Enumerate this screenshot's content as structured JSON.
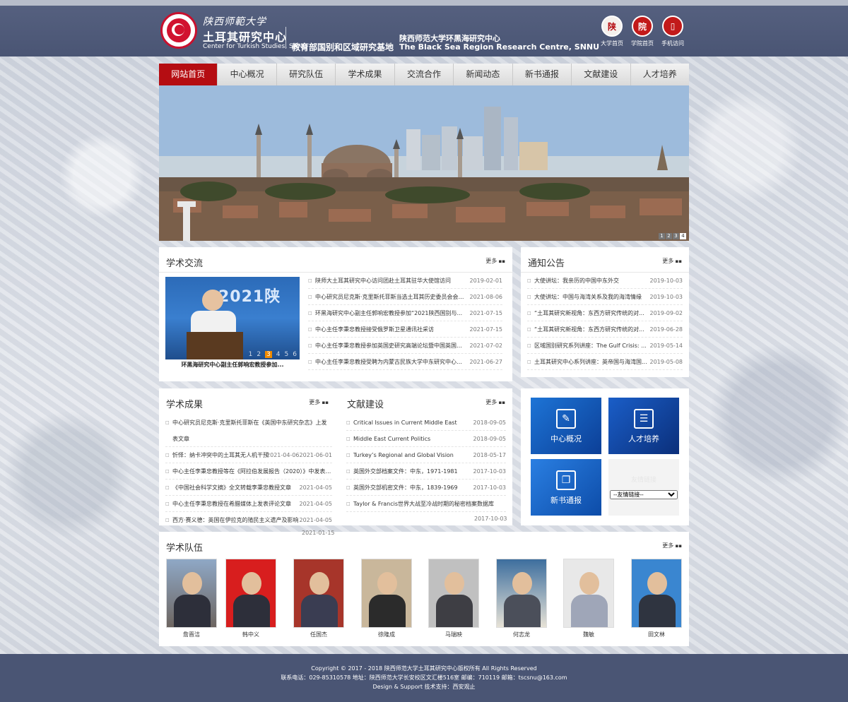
{
  "header": {
    "logo_cn_small": "陕西师範大学",
    "logo_cn_big": "土耳其研究中心",
    "logo_en": "Center for Turkish Studies, SNNU",
    "base_title": "教育部国别和区域研究基地",
    "bsrc_cn": "陕西师范大学环黑海研究中心",
    "bsrc_en": "The Black Sea Region Research Centre, SNNU",
    "quick_links": [
      {
        "label": "大学首页",
        "glyph": "陕"
      },
      {
        "label": "学院首页",
        "glyph": "院"
      },
      {
        "label": "手机访问",
        "glyph": "▯"
      }
    ]
  },
  "nav": [
    "网站首页",
    "中心概况",
    "研究队伍",
    "学术成果",
    "交流合作",
    "新闻动态",
    "新书通报",
    "文献建设",
    "人才培养"
  ],
  "banner": {
    "dots": [
      "1",
      "2",
      "3",
      "4"
    ],
    "active": "4"
  },
  "more_label": "更多",
  "academic_exchange": {
    "title": "学术交流",
    "feature_text": "2021陕",
    "feature_nums": [
      "1",
      "2",
      "3",
      "4",
      "5",
      "6"
    ],
    "feature_active": "3",
    "feature_caption": "环黑海研究中心副主任郭响宏教授参加...",
    "items": [
      {
        "t": "陕师大土耳其研究中心访问团赴土耳其驻华大使馆访问",
        "d": "2019-02-01"
      },
      {
        "t": "中心研究员尼克斯·克里斯托菲斯当选土耳其历史委员会会理事...",
        "d": "2021-08-06"
      },
      {
        "t": "环黑海研究中心副主任郭响宏教授参加“2021陕西国别与...",
        "d": "2021-07-15"
      },
      {
        "t": "中心主任李秉忠教授接受俄罗斯卫星通讯社采访",
        "d": "2021-07-15"
      },
      {
        "t": "中心主任李秉忠教授参加英国史研究高端论坛暨中国英国史...",
        "d": "2021-07-02"
      },
      {
        "t": "中心主任李秉忠教授受聘为内蒙古民族大学中东研究中心学...",
        "d": "2021-06-27"
      }
    ]
  },
  "notice": {
    "title": "通知公告",
    "items": [
      {
        "t": "大使讲坛：我亲历的中国中东外交",
        "d": "2019-10-03"
      },
      {
        "t": "大使讲坛：中国与海湾关系及我的海湾情缘",
        "d": "2019-10-03"
      },
      {
        "t": "“土耳其研究新视角：东西方研究传统的对...",
        "d": "2019-09-02"
      },
      {
        "t": "“土耳其研究新视角：东西方研究传统的对...",
        "d": "2019-06-28"
      },
      {
        "t": "区域国别研究系列讲座：The Gulf Crisis: ...",
        "d": "2019-05-14"
      },
      {
        "t": "土耳其研究中心系列讲座：英帝国与海湾国...",
        "d": "2019-05-08"
      }
    ]
  },
  "achievements": {
    "title": "学术成果",
    "items": [
      {
        "t": "中心研究员尼克斯·克里斯托菲斯在《英国中东研究杂志》上发表文章",
        "d": "",
        "wrap": true
      },
      {
        "t": "忻怿：纳卡冲突中的土耳其无人机干预",
        "d": "2021-04-062021-06-01"
      },
      {
        "t": "中心主任李秉忠教授等在《阿拉伯发展报告（2020）》中发表文章",
        "d": ""
      },
      {
        "t": "《中国社会科学文摘》全文转载李秉忠教授文章",
        "d": "2021-04-05"
      },
      {
        "t": "中心主任李秉忠教授在希腊媒体上发表评论文章",
        "d": "2021-04-05"
      },
      {
        "t": "西方·赛义德：英国在伊拉克的殖民主义遗产及影响",
        "d": "2021-04-05"
      }
    ],
    "last_date": "2021-01-15"
  },
  "literature": {
    "title": "文献建设",
    "items": [
      {
        "t": "Critical Issues in Current Middle East",
        "d": "2018-09-05"
      },
      {
        "t": "Middle East Current Politics",
        "d": "2018-09-05"
      },
      {
        "t": "Turkey’s Regional and Global Vision",
        "d": "2018-05-17"
      },
      {
        "t": "英国外交部档案文件：中东，1971-1981",
        "d": "2017-10-03"
      },
      {
        "t": "英国外交部机密文件：中东，1839-1969",
        "d": "2017-10-03"
      },
      {
        "t": "Taylor & Francis世界大战至冷战时期的秘密档案数据库",
        "d": ""
      }
    ],
    "last_date": "2017-10-03"
  },
  "tiles": [
    {
      "label": "中心概况",
      "icon": "edit-icon",
      "glyph": "✎"
    },
    {
      "label": "人才培养",
      "icon": "person-icon",
      "glyph": "☰"
    },
    {
      "label": "新书通报",
      "icon": "book-icon",
      "glyph": "❐"
    }
  ],
  "friend_links": {
    "heading": "友情链接",
    "selected": "--友情链接--"
  },
  "team": {
    "title": "学术队伍",
    "members": [
      "詹晋洁",
      "韩中义",
      "任国杰",
      "徐隆成",
      "马瑞映",
      "何志龙",
      "魏敏",
      "田文林"
    ]
  },
  "footer": {
    "line1": "Copyright © 2017 - 2018 陕西师范大学土耳其研究中心版权所有 All Rights Reserved",
    "line2": "联系电话：029-85310578 地址：陕西师范大学长安校区文汇楼516室 邮编：710119 邮箱：tscsnu@163.com",
    "line3": "Design & Support 技术支持：西安观止"
  },
  "colors": {
    "header_bg": "#4a5574",
    "nav_active": "#b50d12",
    "tile_blue": "#1d74d6"
  }
}
